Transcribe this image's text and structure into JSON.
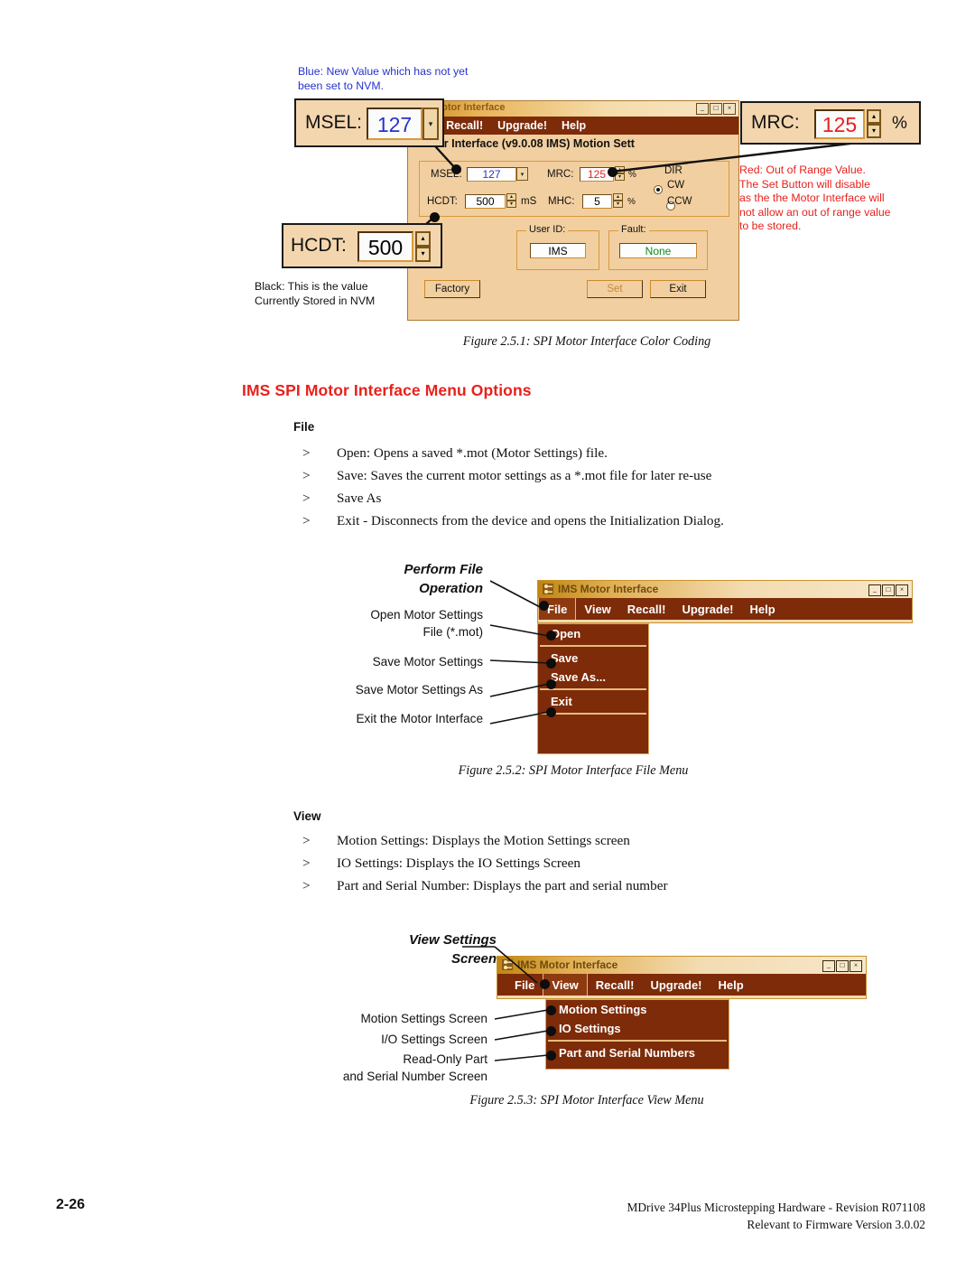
{
  "figure1": {
    "note_blue": "Blue: New Value which has not yet\nbeen set to NVM.",
    "note_red": "Red: Out of Range Value.\nThe Set Button will disable\nas the the Motor Interface will\nnot allow an out of range value\nto be stored.",
    "note_black": "Black: This is the value\nCurrently Stored in NVM",
    "window": {
      "title": "Motor Interface",
      "screen_title": "tor Interface (v9.0.08 IMS) Motion Sett",
      "menus": [
        "iew",
        "Recall!",
        "Upgrade!",
        "Help"
      ],
      "win_buttons": [
        "_",
        "□",
        "×"
      ],
      "fields": {
        "msel_label": "MSEL:",
        "msel_value": "127",
        "mrc_label": "MRC:",
        "mrc_value": "125",
        "mrc_unit": "%",
        "hcdt_label": "HCDT:",
        "hcdt_value": "500",
        "hcdt_unit": "mS",
        "mhc_label": "MHC:",
        "mhc_value": "5",
        "mhc_unit": "%",
        "dir_label": "DIR",
        "dir_cw": "CW",
        "dir_ccw": "CCW",
        "userid_legend": "User ID:",
        "userid_value": "IMS",
        "fault_legend": "Fault:",
        "fault_value": "None"
      },
      "buttons": {
        "factory": "Factory",
        "set": "Set",
        "exit": "Exit"
      }
    },
    "callouts": {
      "msel_label": "MSEL:",
      "msel_value": "127",
      "mrc_label": "MRC:",
      "mrc_value": "125",
      "mrc_percent": "%",
      "hcdt_label": "HCDT:",
      "hcdt_value": "500"
    },
    "caption": "Figure 2.5.1: SPI Motor Interface Color Coding"
  },
  "section": {
    "heading": "IMS SPI Motor Interface Menu Options",
    "file_heading": "File",
    "file_bullets": [
      "Open: Opens a saved *.mot (Motor Settings) file.",
      "Save: Saves the current motor settings as a *.mot file for later re-use",
      "Save As",
      "Exit - Disconnects from the device and opens the Initialization Dialog."
    ],
    "view_heading": "View",
    "view_bullets": [
      "Motion Settings: Displays the Motion Settings screen",
      "IO Settings: Displays the IO Settings Screen",
      "Part and Serial Number: Displays the part and serial number"
    ],
    "bullet_marker": ">"
  },
  "figure2": {
    "annotations": {
      "title": "Perform File\nOperation",
      "open": "Open Motor Settings\nFile (*.mot)",
      "save": "Save Motor Settings",
      "save_as": "Save Motor Settings As",
      "exit": "Exit the Motor Interface"
    },
    "window": {
      "title": "IMS Motor Interface",
      "win_buttons": [
        "_",
        "□",
        "×"
      ],
      "menus": [
        "File",
        "View",
        "Recall!",
        "Upgrade!",
        "Help"
      ],
      "selected_menu": "File",
      "dropdown_items": [
        "Open",
        "Save",
        "Save As...",
        "Exit"
      ]
    },
    "caption": "Figure 2.5.2: SPI Motor Interface File Menu"
  },
  "figure3": {
    "annotations": {
      "title": "View Settings\nScreen",
      "motion": "Motion Settings Screen",
      "io": "I/O Settings Screen",
      "part": "Read-Only Part\nand Serial Number Screen"
    },
    "window": {
      "title": "IMS Motor Interface",
      "win_buttons": [
        "_",
        "□",
        "×"
      ],
      "menus": [
        "File",
        "View",
        "Recall!",
        "Upgrade!",
        "Help"
      ],
      "selected_menu": "View",
      "dropdown_items": [
        "Motion Settings",
        "IO Settings",
        "Part and Serial Numbers"
      ]
    },
    "caption": "Figure 2.5.3: SPI Motor Interface View Menu"
  },
  "footer": {
    "page_number": "2-26",
    "right_text": "MDrive 34Plus Microstepping Hardware - Revision R071108\nRelevant to Firmware Version 3.0.02"
  }
}
